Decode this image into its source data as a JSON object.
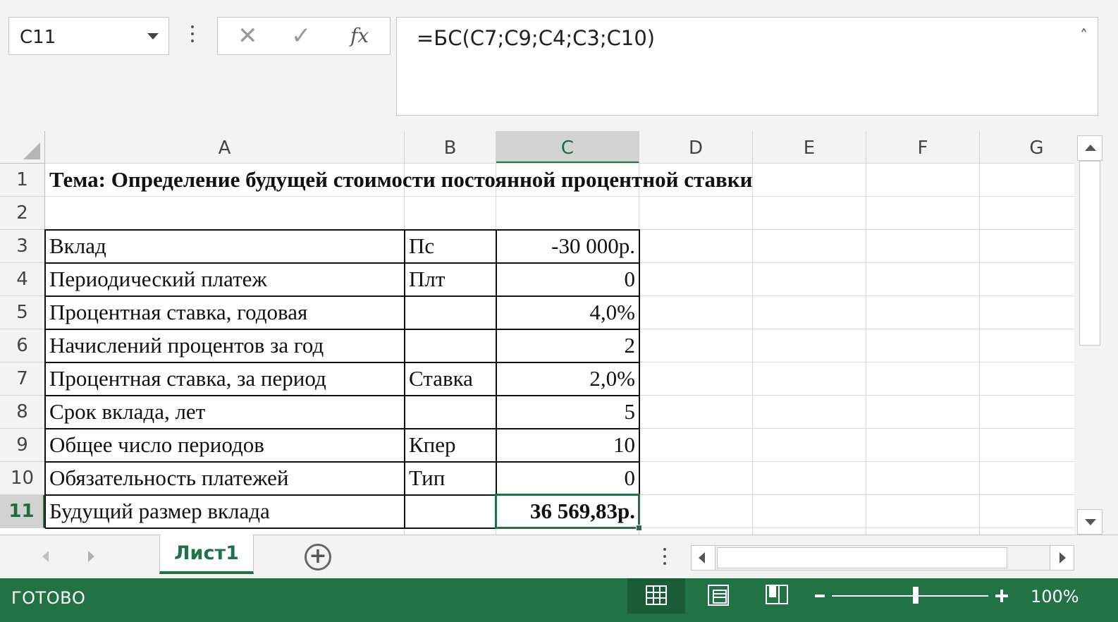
{
  "formula_bar": {
    "name_box": "C11",
    "cancel_glyph": "✕",
    "enter_glyph": "✓",
    "fx_glyph": "fx",
    "formula": "=БС(C7;C9;C4;C3;C10)",
    "collapse_glyph": "˄"
  },
  "columns": [
    "A",
    "B",
    "C",
    "D",
    "E",
    "F",
    "G"
  ],
  "rows": [
    "1",
    "2",
    "3",
    "4",
    "5",
    "6",
    "7",
    "8",
    "9",
    "10",
    "11"
  ],
  "selected": {
    "column": "C",
    "row": "11"
  },
  "cells": {
    "A1": "Тема: Определение будущей стоимости постоянной процентной ставки",
    "A3": "Вклад",
    "B3": "Пс",
    "C3": "-30 000р.",
    "A4": "Периодический платеж",
    "B4": "Плт",
    "C4": "0",
    "A5": "Процентная ставка, годовая",
    "B5": "",
    "C5": "4,0%",
    "A6": "Начислений процентов за год",
    "B6": "",
    "C6": "2",
    "A7": "Процентная ставка, за период",
    "B7": "Ставка",
    "C7": "2,0%",
    "A8": "Срок вклада, лет",
    "B8": "",
    "C8": "5",
    "A9": "Общее число периодов",
    "B9": "Кпер",
    "C9": "10",
    "A10": "Обязательность платежей",
    "B10": "Тип",
    "C10": "0",
    "A11": "Будущий размер вклада",
    "B11": "",
    "C11": "36 569,83р."
  },
  "sheets": {
    "active": "Лист1",
    "add_glyph": "+"
  },
  "status": {
    "text": "ГОТОВО",
    "zoom_label": "100%",
    "zoom_level": 1.0
  },
  "colors": {
    "accent": "#217346"
  }
}
